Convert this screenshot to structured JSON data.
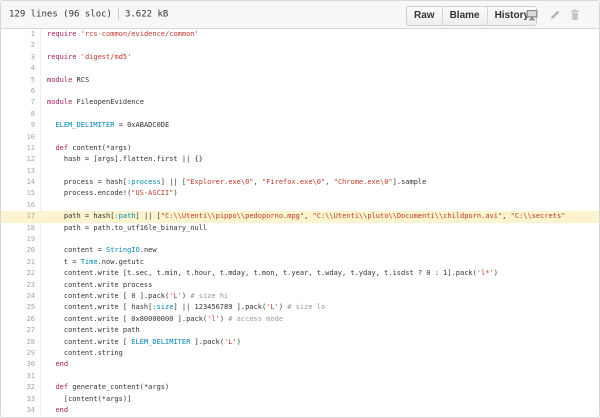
{
  "file": {
    "lines_info": "129 lines (96 sloc)",
    "size": "3.622 kB"
  },
  "buttons": {
    "raw": "Raw",
    "blame": "Blame",
    "history": "History"
  },
  "icons": {
    "desktop": "desktop-icon",
    "edit": "pencil-icon",
    "delete": "trash-icon"
  },
  "colors": {
    "highlight_row": "#fbf4cf",
    "string": "#c0392b",
    "keyword": "#a71d5d",
    "constant": "#0086b3"
  },
  "lines": [
    {
      "n": "1",
      "text": "require 'rcs-common/evidence/common'"
    },
    {
      "n": "2",
      "text": ""
    },
    {
      "n": "3",
      "text": "require 'digest/md5'"
    },
    {
      "n": "4",
      "text": ""
    },
    {
      "n": "5",
      "text": "module RCS"
    },
    {
      "n": "6",
      "text": ""
    },
    {
      "n": "7",
      "text": "module FileopenEvidence"
    },
    {
      "n": "8",
      "text": ""
    },
    {
      "n": "9",
      "text": "  ELEM_DELIMITER = 0xABADC0DE"
    },
    {
      "n": "10",
      "text": ""
    },
    {
      "n": "11",
      "text": "  def content(*args)"
    },
    {
      "n": "12",
      "text": "    hash = [args].flatten.first || {}"
    },
    {
      "n": "13",
      "text": ""
    },
    {
      "n": "14",
      "text": "    process = hash[:process] || [\"Explorer.exe\\0\", \"Firefox.exe\\0\", \"Chrome.exe\\0\"].sample"
    },
    {
      "n": "15",
      "text": "    process.encode!(\"US-ASCII\")"
    },
    {
      "n": "16",
      "text": ""
    },
    {
      "n": "17",
      "text": "    path = hash[:path] || [\"C:\\\\Utenti\\\\pippo\\\\pedoporno.mpg\", \"C:\\\\Utenti\\\\pluto\\\\Documenti\\\\childporn.avi\", \"C:\\\\secrets\""
    },
    {
      "n": "18",
      "text": "    path = path.to_utf16le_binary_null"
    },
    {
      "n": "19",
      "text": ""
    },
    {
      "n": "20",
      "text": "    content = StringIO.new"
    },
    {
      "n": "21",
      "text": "    t = Time.now.getutc"
    },
    {
      "n": "22",
      "text": "    content.write [t.sec, t.min, t.hour, t.mday, t.mon, t.year, t.wday, t.yday, t.isdst ? 0 : 1].pack('l*')"
    },
    {
      "n": "23",
      "text": "    content.write process"
    },
    {
      "n": "24",
      "text": "    content.write [ 0 ].pack('L') # size hi"
    },
    {
      "n": "25",
      "text": "    content.write [ hash[:size] || 123456789 ].pack('L') # size lo"
    },
    {
      "n": "26",
      "text": "    content.write [ 0x80000000 ].pack('l') # access mode"
    },
    {
      "n": "27",
      "text": "    content.write path"
    },
    {
      "n": "28",
      "text": "    content.write [ ELEM_DELIMITER ].pack('L')"
    },
    {
      "n": "29",
      "text": "    content.string"
    },
    {
      "n": "30",
      "text": "  end"
    },
    {
      "n": "31",
      "text": ""
    },
    {
      "n": "32",
      "text": "  def generate_content(*args)"
    },
    {
      "n": "33",
      "text": "    [content(*args)]"
    },
    {
      "n": "34",
      "text": "  end"
    }
  ],
  "highlighted_line": "17"
}
